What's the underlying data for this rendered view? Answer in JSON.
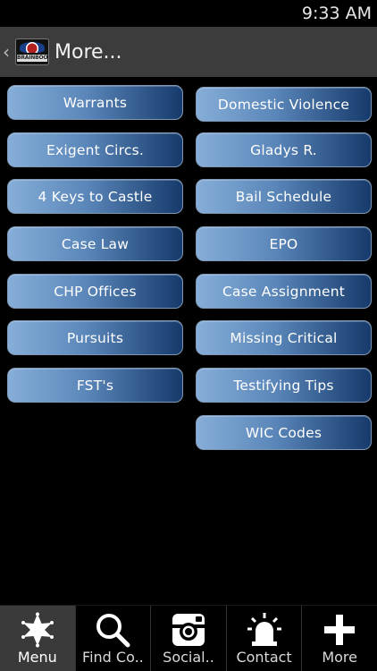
{
  "status_bar": {
    "time": "9:33 AM"
  },
  "action_bar": {
    "back_icon": "chevron-left-icon",
    "logo_text": "BRAINBOOK",
    "title": "More..."
  },
  "menu": {
    "left": [
      "Warrants",
      "Exigent Circs.",
      "4 Keys to Castle",
      "Case Law",
      "CHP Offices",
      "Pursuits",
      "FST's"
    ],
    "right": [
      "Domestic Violence",
      "Gladys R.",
      "Bail Schedule",
      "EPO",
      "Case Assignment",
      "Missing Critical",
      "Testifying Tips",
      "WIC Codes"
    ]
  },
  "bottom_nav": {
    "items": [
      {
        "label": "Menu",
        "icon": "sheriff-star-icon",
        "active": true
      },
      {
        "label": "Find Co..",
        "icon": "search-icon",
        "active": false
      },
      {
        "label": "Social..",
        "icon": "instagram-icon",
        "active": false
      },
      {
        "label": "Contact",
        "icon": "siren-icon",
        "active": false
      },
      {
        "label": "More",
        "icon": "plus-icon",
        "active": false
      }
    ]
  }
}
